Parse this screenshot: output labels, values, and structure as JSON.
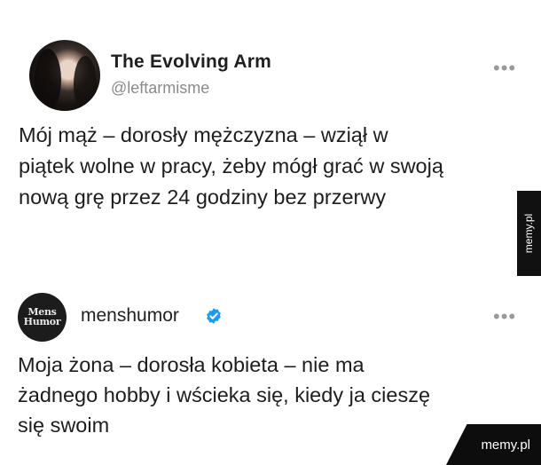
{
  "post1": {
    "name": "The Evolving Arm",
    "handle": "@leftarmisme",
    "more": "•••",
    "text_lines": [
      "Mój mąż – dorosły mężczyzna – wziął w",
      "piątek wolne w pracy, żeby mógł grać w swoją",
      "nową grę przez 24 godziny bez przerwy"
    ]
  },
  "post2": {
    "name": "menshumor",
    "avatar_text": [
      "Mens",
      "Humor"
    ],
    "more": "•••",
    "verified_color": "#1d9bf0",
    "text_lines": [
      "Moja żona – dorosła kobieta – nie ma",
      "żadnego hobby i wścieka się, kiedy ja cieszę",
      "się swoim"
    ]
  },
  "watermark": {
    "side": "memy.pl",
    "bottom": "memy.pl"
  }
}
